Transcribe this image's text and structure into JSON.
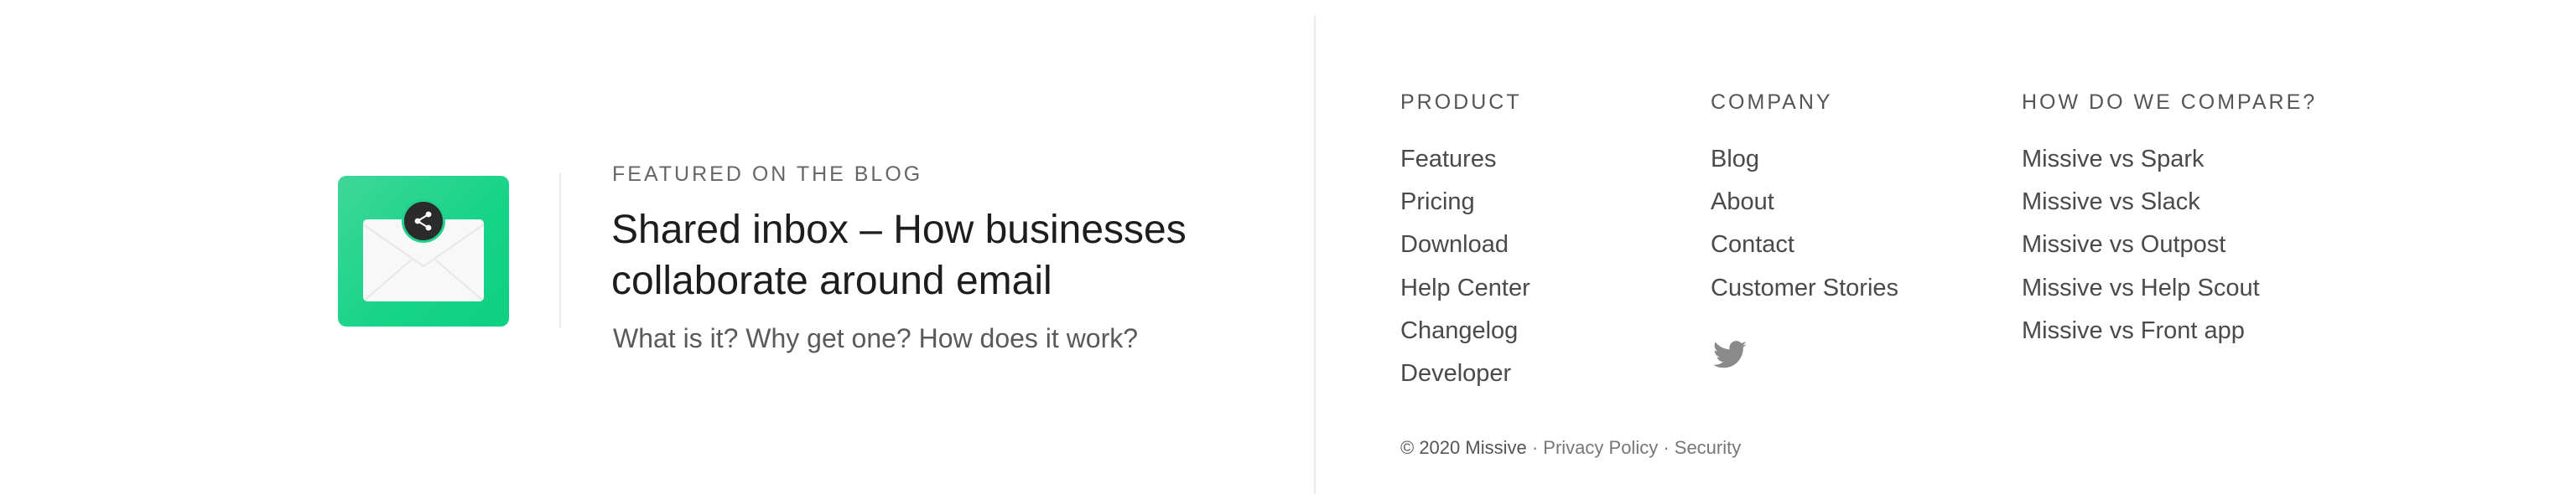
{
  "featured": {
    "label": "FEATURED ON THE BLOG",
    "title": "Shared inbox – How businesses collaborate around email",
    "subtitle": "What is it? Why get one? How does it work?",
    "image_icon": "envelope-share-icon",
    "accent_color": "#15d487"
  },
  "footer": {
    "product": {
      "heading": "PRODUCT",
      "links": [
        "Features",
        "Pricing",
        "Download",
        "Help Center",
        "Changelog",
        "Developer"
      ]
    },
    "company": {
      "heading": "COMPANY",
      "links": [
        "Blog",
        "About",
        "Contact",
        "Customer Stories"
      ],
      "social_icon": "twitter-icon"
    },
    "compare": {
      "heading": "HOW DO WE COMPARE?",
      "links": [
        "Missive vs Spark",
        "Missive vs Slack",
        "Missive vs Outpost",
        "Missive vs Help Scout",
        "Missive vs Front app"
      ]
    },
    "legal": {
      "copyright": "© 2020 Missive",
      "separator": " · ",
      "privacy": "Privacy Policy",
      "security": "Security"
    }
  }
}
